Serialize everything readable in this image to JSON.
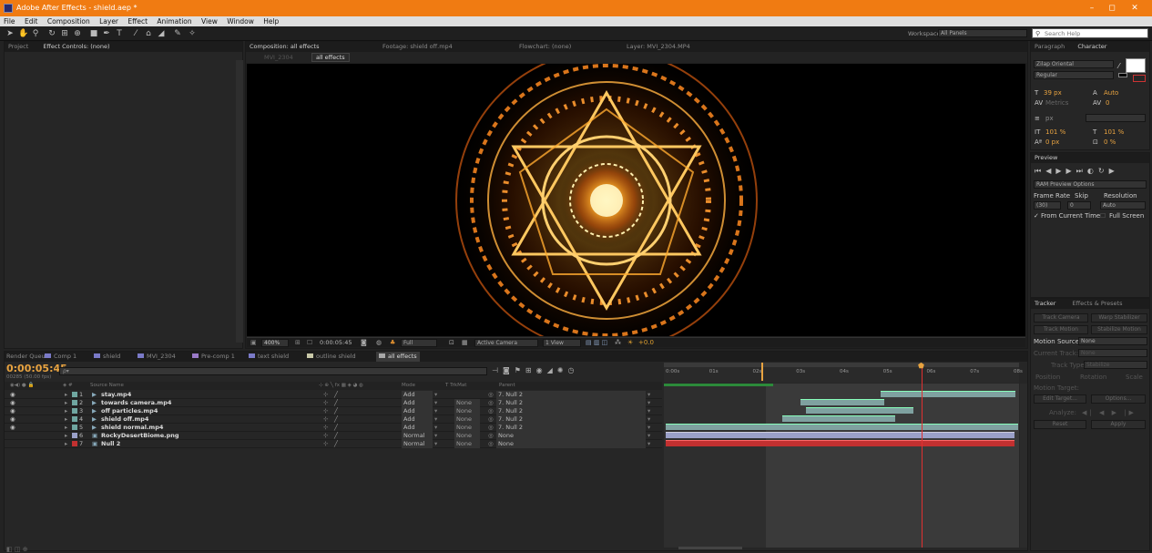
{
  "window": {
    "title": "Adobe After Effects - shield.aep *",
    "minimize": "–",
    "maximize": "◻",
    "close": "✕"
  },
  "menu": [
    "File",
    "Edit",
    "Composition",
    "Layer",
    "Effect",
    "Animation",
    "View",
    "Window",
    "Help"
  ],
  "toolbar": {
    "workspace_label": "Workspace:",
    "workspace_value": "All Panels",
    "search_placeholder": "Search Help"
  },
  "left_panel": {
    "tab_project": "Project",
    "tab_effect_controls": "Effect Controls: (none)"
  },
  "comp_panel": {
    "tab_composition": "Composition: all effects",
    "tab_footage": "Footage: shield off.mp4",
    "tab_flowchart": "Flowchart: (none)",
    "tab_layer": "Layer: MVI_2304.MP4",
    "breadcrumb_prev": "MVI_2304",
    "breadcrumb_current": "all effects"
  },
  "viewer_footer": {
    "zoom": "400%",
    "timecode": "0:00:05:45",
    "resolution": "Full",
    "camera": "Active Camera",
    "views": "1 View",
    "exposure": "+0.0"
  },
  "character": {
    "tab_paragraph": "Paragraph",
    "tab_character": "Character",
    "font": "Zilap Oriental",
    "style": "Regular",
    "size": "39 px",
    "leading": "Auto",
    "kerning": "Metrics",
    "tracking": "0",
    "stroke": "px",
    "vscale": "101 %",
    "hscale": "101 %",
    "baseline": "0 px",
    "tsume": "0 %"
  },
  "preview": {
    "title": "Preview",
    "options": "RAM Preview Options",
    "frame_rate_label": "Frame Rate",
    "skip_label": "Skip",
    "resolution_label": "Resolution",
    "frame_rate": "(30)",
    "skip": "0",
    "resolution": "Auto",
    "from_current": "From Current Time",
    "full_screen": "Full Screen"
  },
  "tracker": {
    "tab_tracker": "Tracker",
    "tab_effects": "Effects & Presets",
    "track_camera": "Track Camera",
    "warp_stabilizer": "Warp Stabilizer",
    "track_motion": "Track Motion",
    "stabilize_motion": "Stabilize Motion",
    "motion_source_label": "Motion Source:",
    "motion_source": "None",
    "current_track_label": "Current Track:",
    "current_track": "None",
    "track_type_label": "Track Type:",
    "track_type": "Stabilize",
    "position": "Position",
    "rotation": "Rotation",
    "scale": "Scale",
    "motion_target": "Motion Target:",
    "edit_target": "Edit Target...",
    "options": "Options...",
    "analyze": "Analyze:",
    "reset": "Reset",
    "apply": "Apply"
  },
  "timeline": {
    "tabs": [
      "Render Queue",
      "Comp 1",
      "shield",
      "MVI_2304",
      "Pre-comp 1",
      "text shield",
      "outline shield",
      "all effects"
    ],
    "label_colors": [
      "#7a7ac8",
      "#7a7ac8",
      "#7a7ac8",
      "#7a7ac8",
      "#9a7ac8",
      "#7a7ac8",
      "#c8c8a8",
      "#a8a8a8"
    ],
    "timecode": "0:00:05:45",
    "fps_note": "00285 (50.00 fps)",
    "search_placeholder": "ρ▾",
    "col_source": "Source Name",
    "col_mode": "Mode",
    "col_trkmat": "T  TrkMat",
    "col_parent": "Parent",
    "ruler": [
      "0:00s",
      "01s",
      "02s",
      "03s",
      "04s",
      "05s",
      "06s",
      "07s",
      "08s"
    ],
    "layers": [
      {
        "num": "1",
        "name": "stay.mp4",
        "mode": "Add",
        "trkmat": "",
        "parent": "7. Null 2",
        "color": "#6fa6a0"
      },
      {
        "num": "2",
        "name": "towards camera.mp4",
        "mode": "Add",
        "trkmat": "None",
        "parent": "7. Null 2",
        "color": "#6fa6a0"
      },
      {
        "num": "3",
        "name": "off particles.mp4",
        "mode": "Add",
        "trkmat": "None",
        "parent": "7. Null 2",
        "color": "#6fa6a0"
      },
      {
        "num": "4",
        "name": "shield off.mp4",
        "mode": "Add",
        "trkmat": "None",
        "parent": "7. Null 2",
        "color": "#6fa6a0"
      },
      {
        "num": "5",
        "name": "shield normal.mp4",
        "mode": "Add",
        "trkmat": "None",
        "parent": "7. Null 2",
        "color": "#6fa6a0"
      },
      {
        "num": "6",
        "name": "RockyDesertBiome.png",
        "mode": "Normal",
        "trkmat": "None",
        "parent": "None",
        "color": "#9aa0c8"
      },
      {
        "num": "7",
        "name": "Null 2",
        "mode": "Normal",
        "trkmat": "None",
        "parent": "None",
        "color": "#c23030"
      }
    ]
  }
}
